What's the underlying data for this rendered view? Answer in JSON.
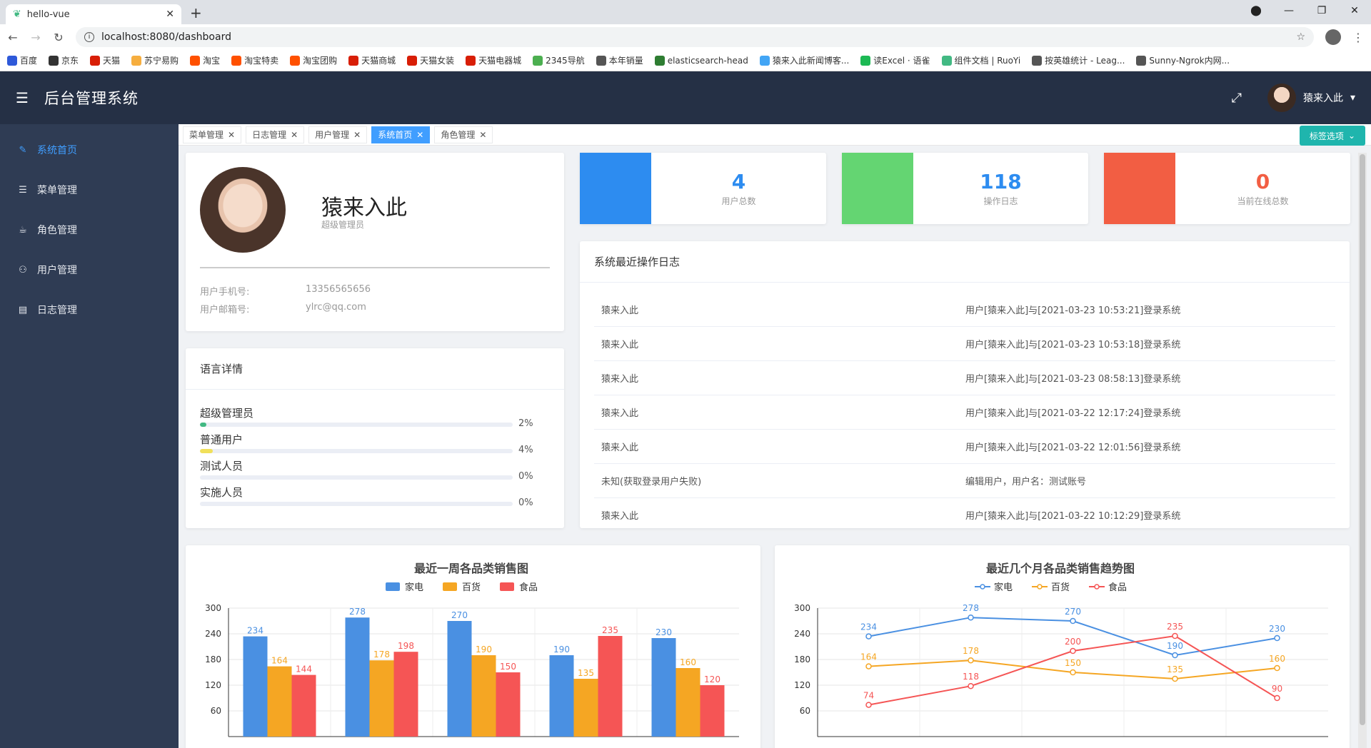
{
  "browser": {
    "tab_title": "hello-vue",
    "url": "localhost:8080/dashboard",
    "bookmarks": [
      "百度",
      "京东",
      "天猫",
      "苏宁易购",
      "淘宝",
      "淘宝特卖",
      "淘宝团购",
      "天猫商城",
      "天猫女装",
      "天猫电器城",
      "2345导航",
      "本年销量",
      "elasticsearch-head",
      "猿来入此新闻博客...",
      "读Excel · 语雀",
      "组件文档 | RuoYi",
      "按英雄统计 - Leag...",
      "Sunny-Ngrok内网..."
    ],
    "bookmark_colors": [
      "#2e59d9",
      "#333333",
      "#d81e06",
      "#f6ae3f",
      "#ff5000",
      "#ff5000",
      "#ff5000",
      "#d81e06",
      "#d81e06",
      "#d81e06",
      "#4caf50",
      "#555555",
      "#2e7d32",
      "#42a5f5",
      "#1db954",
      "#42b983",
      "#555555",
      "#555555"
    ]
  },
  "header": {
    "title": "后台管理系统",
    "username": "猿来入此"
  },
  "sidebar": {
    "items": [
      {
        "label": "系统首页",
        "icon": "dashboard-icon",
        "glyph": "✎"
      },
      {
        "label": "菜单管理",
        "icon": "menu-icon",
        "glyph": "☰"
      },
      {
        "label": "角色管理",
        "icon": "role-icon",
        "glyph": "☕"
      },
      {
        "label": "用户管理",
        "icon": "user-icon",
        "glyph": "⚇"
      },
      {
        "label": "日志管理",
        "icon": "log-icon",
        "glyph": "▤"
      }
    ]
  },
  "tags": {
    "items": [
      "菜单管理",
      "日志管理",
      "用户管理",
      "系统首页",
      "角色管理"
    ],
    "active": "系统首页",
    "options_label": "标签选项"
  },
  "profile": {
    "name": "猿来入此",
    "role": "超级管理员",
    "phone_label": "用户手机号:",
    "phone": "13356565656",
    "email_label": "用户邮箱号:",
    "email": "ylrc@qq.com"
  },
  "lang": {
    "title": "语言详情",
    "items": [
      {
        "label": "超级管理员",
        "percent": 2,
        "value": "2%",
        "color": "#42b983"
      },
      {
        "label": "普通用户",
        "percent": 4,
        "value": "4%",
        "color": "#f1e05a"
      },
      {
        "label": "测试人员",
        "percent": 0,
        "value": "0%",
        "color": "#f56c6c"
      },
      {
        "label": "实施人员",
        "percent": 0,
        "value": "0%",
        "color": "#f56c6c"
      }
    ]
  },
  "stats": [
    {
      "value": "4",
      "label": "用户总数",
      "color": "#2d8cf0",
      "num_color": "#2d8cf0"
    },
    {
      "value": "118",
      "label": "操作日志",
      "color": "#64d572",
      "num_color": "#2d8cf0"
    },
    {
      "value": "0",
      "label": "当前在线总数",
      "color": "#f25e43",
      "num_color": "#f25e43"
    }
  ],
  "logs": {
    "title": "系统最近操作日志",
    "rows": [
      {
        "user": "猿来入此",
        "action": "用户[猿来入此]与[2021-03-23 10:53:21]登录系统"
      },
      {
        "user": "猿来入此",
        "action": "用户[猿来入此]与[2021-03-23 10:53:18]登录系统"
      },
      {
        "user": "猿来入此",
        "action": "用户[猿来入此]与[2021-03-23 08:58:13]登录系统"
      },
      {
        "user": "猿来入此",
        "action": "用户[猿来入此]与[2021-03-22 12:17:24]登录系统"
      },
      {
        "user": "猿来入此",
        "action": "用户[猿来入此]与[2021-03-22 12:01:56]登录系统"
      },
      {
        "user": "未知(获取登录用户失败)",
        "action": "编辑用户，用户名：测试账号"
      },
      {
        "user": "猿来入此",
        "action": "用户[猿来入此]与[2021-03-22 10:12:29]登录系统"
      }
    ]
  },
  "colors": {
    "series": [
      "#4a90e2",
      "#f5a623",
      "#f55555"
    ]
  },
  "chart_data": [
    {
      "type": "bar",
      "title": "最近一周各品类销售图",
      "ylim": [
        0,
        300
      ],
      "yticks": [
        60,
        120,
        180,
        240,
        300
      ],
      "grid": true,
      "legend": "top-center",
      "series": [
        {
          "name": "家电",
          "values": [
            234,
            278,
            270,
            190,
            230
          ]
        },
        {
          "name": "百货",
          "values": [
            164,
            178,
            190,
            135,
            160
          ]
        },
        {
          "name": "食品",
          "values": [
            144,
            198,
            150,
            235,
            120
          ]
        }
      ]
    },
    {
      "type": "line",
      "title": "最近几个月各品类销售趋势图",
      "ylim": [
        0,
        300
      ],
      "yticks": [
        60,
        120,
        180,
        240,
        300
      ],
      "grid": true,
      "legend": "top-center",
      "series": [
        {
          "name": "家电",
          "values": [
            234,
            278,
            270,
            190,
            230
          ]
        },
        {
          "name": "百货",
          "values": [
            164,
            178,
            150,
            135,
            160
          ]
        },
        {
          "name": "食品",
          "values": [
            74,
            118,
            200,
            235,
            90
          ]
        }
      ]
    }
  ]
}
